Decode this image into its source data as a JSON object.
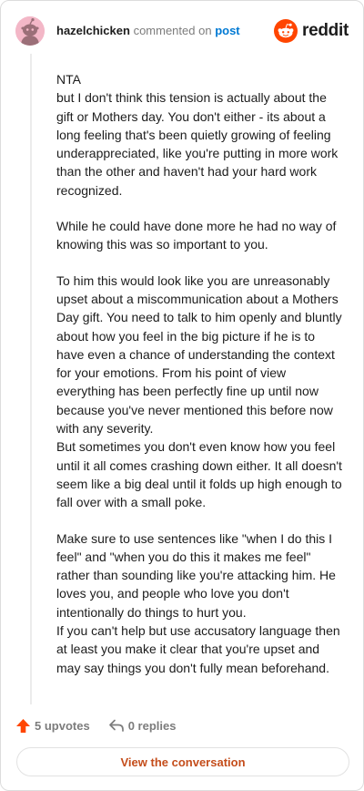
{
  "header": {
    "username": "hazelchicken",
    "action": "commented on",
    "post_link": "post",
    "brand": "reddit"
  },
  "comment": {
    "paragraphs": [
      "NTA\nbut I don't think this tension is actually about the gift or Mothers day. You don't either - its about a long feeling that's been quietly growing of feeling underappreciated, like you're putting in more work than the other and haven't had your hard work recognized.",
      "While he could have done more he had no way of knowing this was so important to you.",
      "To him this would look like you are unreasonably upset about a miscommunication about a Mothers Day gift. You need to talk to him openly and bluntly about how you feel in the big picture if he is to have even a chance of understanding the context for your emotions. From his point of view everything has been perfectly fine up until now because you've never mentioned this before now with any severity.\nBut sometimes you don't even know how you feel until it all comes crashing down either. It all doesn't seem like a big deal until it folds up high enough to fall over with a small poke.",
      "Make sure to use sentences like \"when I do this I feel\" and \"when you do this it makes me feel\" rather than sounding like you're attacking him. He loves you, and people who love you don't intentionally do things to hurt you.\nIf you can't help but use accusatory language then at least you make it clear that you're upset and may say things you don't fully mean beforehand."
    ]
  },
  "footer": {
    "upvotes_label": "5 upvotes",
    "replies_label": "0 replies",
    "cta_label": "View the conversation"
  },
  "colors": {
    "upvote": "#ff4500",
    "reddit_orange": "#ff4500",
    "link": "#0079d3",
    "cta_text": "#c44d1b"
  },
  "icons": {
    "avatar": "snoo-avatar",
    "brand": "reddit-logo-icon",
    "upvote": "upvote-arrow-icon",
    "reply": "reply-arrow-icon"
  }
}
